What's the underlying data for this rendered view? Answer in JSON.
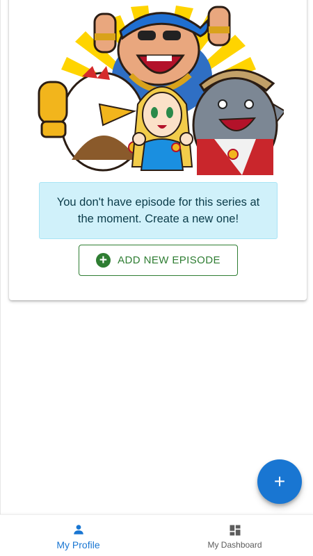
{
  "empty_state": {
    "illustration_icon": "cartoon-characters-illustration",
    "message": "You don't have episode for this series at the moment. Create a new one!",
    "add_button_label": "ADD NEW EPISODE",
    "add_button_icon": "add-circle-icon"
  },
  "fab": {
    "label": "+",
    "icon": "add-icon"
  },
  "bottom_nav": {
    "items": [
      {
        "label": "My Profile",
        "icon": "person-icon",
        "active": true
      },
      {
        "label": "My Dashboard",
        "icon": "dashboard-icon",
        "active": false
      }
    ]
  },
  "colors": {
    "primary": "#1976d2",
    "success": "#2e7d32",
    "info_bg": "#d0f1fa",
    "info_text": "#0a3b49"
  }
}
